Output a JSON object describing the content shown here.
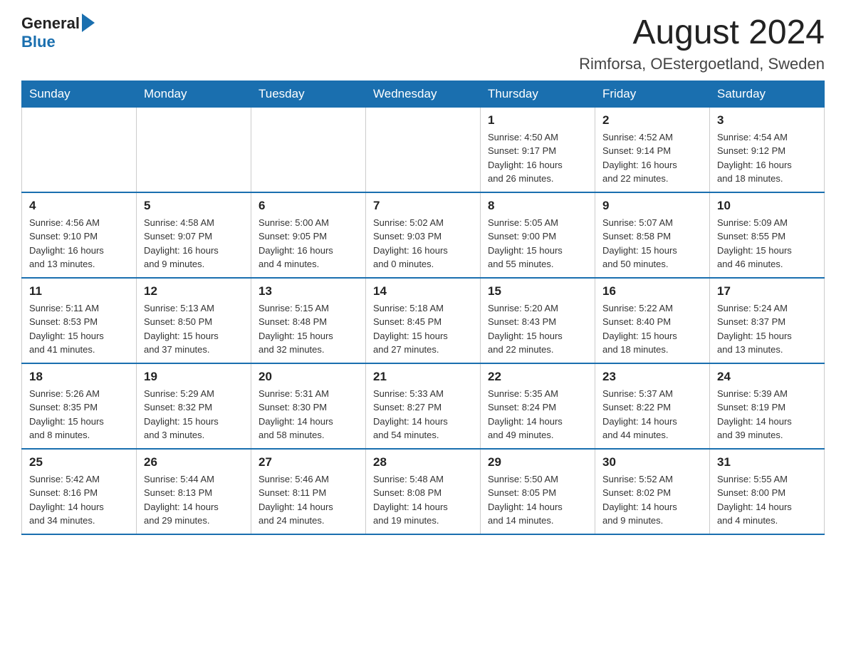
{
  "header": {
    "logo_general": "General",
    "logo_blue": "Blue",
    "month_year": "August 2024",
    "location": "Rimforsa, OEstergoetland, Sweden"
  },
  "days_of_week": [
    "Sunday",
    "Monday",
    "Tuesday",
    "Wednesday",
    "Thursday",
    "Friday",
    "Saturday"
  ],
  "weeks": [
    [
      {
        "day": "",
        "info": ""
      },
      {
        "day": "",
        "info": ""
      },
      {
        "day": "",
        "info": ""
      },
      {
        "day": "",
        "info": ""
      },
      {
        "day": "1",
        "info": "Sunrise: 4:50 AM\nSunset: 9:17 PM\nDaylight: 16 hours\nand 26 minutes."
      },
      {
        "day": "2",
        "info": "Sunrise: 4:52 AM\nSunset: 9:14 PM\nDaylight: 16 hours\nand 22 minutes."
      },
      {
        "day": "3",
        "info": "Sunrise: 4:54 AM\nSunset: 9:12 PM\nDaylight: 16 hours\nand 18 minutes."
      }
    ],
    [
      {
        "day": "4",
        "info": "Sunrise: 4:56 AM\nSunset: 9:10 PM\nDaylight: 16 hours\nand 13 minutes."
      },
      {
        "day": "5",
        "info": "Sunrise: 4:58 AM\nSunset: 9:07 PM\nDaylight: 16 hours\nand 9 minutes."
      },
      {
        "day": "6",
        "info": "Sunrise: 5:00 AM\nSunset: 9:05 PM\nDaylight: 16 hours\nand 4 minutes."
      },
      {
        "day": "7",
        "info": "Sunrise: 5:02 AM\nSunset: 9:03 PM\nDaylight: 16 hours\nand 0 minutes."
      },
      {
        "day": "8",
        "info": "Sunrise: 5:05 AM\nSunset: 9:00 PM\nDaylight: 15 hours\nand 55 minutes."
      },
      {
        "day": "9",
        "info": "Sunrise: 5:07 AM\nSunset: 8:58 PM\nDaylight: 15 hours\nand 50 minutes."
      },
      {
        "day": "10",
        "info": "Sunrise: 5:09 AM\nSunset: 8:55 PM\nDaylight: 15 hours\nand 46 minutes."
      }
    ],
    [
      {
        "day": "11",
        "info": "Sunrise: 5:11 AM\nSunset: 8:53 PM\nDaylight: 15 hours\nand 41 minutes."
      },
      {
        "day": "12",
        "info": "Sunrise: 5:13 AM\nSunset: 8:50 PM\nDaylight: 15 hours\nand 37 minutes."
      },
      {
        "day": "13",
        "info": "Sunrise: 5:15 AM\nSunset: 8:48 PM\nDaylight: 15 hours\nand 32 minutes."
      },
      {
        "day": "14",
        "info": "Sunrise: 5:18 AM\nSunset: 8:45 PM\nDaylight: 15 hours\nand 27 minutes."
      },
      {
        "day": "15",
        "info": "Sunrise: 5:20 AM\nSunset: 8:43 PM\nDaylight: 15 hours\nand 22 minutes."
      },
      {
        "day": "16",
        "info": "Sunrise: 5:22 AM\nSunset: 8:40 PM\nDaylight: 15 hours\nand 18 minutes."
      },
      {
        "day": "17",
        "info": "Sunrise: 5:24 AM\nSunset: 8:37 PM\nDaylight: 15 hours\nand 13 minutes."
      }
    ],
    [
      {
        "day": "18",
        "info": "Sunrise: 5:26 AM\nSunset: 8:35 PM\nDaylight: 15 hours\nand 8 minutes."
      },
      {
        "day": "19",
        "info": "Sunrise: 5:29 AM\nSunset: 8:32 PM\nDaylight: 15 hours\nand 3 minutes."
      },
      {
        "day": "20",
        "info": "Sunrise: 5:31 AM\nSunset: 8:30 PM\nDaylight: 14 hours\nand 58 minutes."
      },
      {
        "day": "21",
        "info": "Sunrise: 5:33 AM\nSunset: 8:27 PM\nDaylight: 14 hours\nand 54 minutes."
      },
      {
        "day": "22",
        "info": "Sunrise: 5:35 AM\nSunset: 8:24 PM\nDaylight: 14 hours\nand 49 minutes."
      },
      {
        "day": "23",
        "info": "Sunrise: 5:37 AM\nSunset: 8:22 PM\nDaylight: 14 hours\nand 44 minutes."
      },
      {
        "day": "24",
        "info": "Sunrise: 5:39 AM\nSunset: 8:19 PM\nDaylight: 14 hours\nand 39 minutes."
      }
    ],
    [
      {
        "day": "25",
        "info": "Sunrise: 5:42 AM\nSunset: 8:16 PM\nDaylight: 14 hours\nand 34 minutes."
      },
      {
        "day": "26",
        "info": "Sunrise: 5:44 AM\nSunset: 8:13 PM\nDaylight: 14 hours\nand 29 minutes."
      },
      {
        "day": "27",
        "info": "Sunrise: 5:46 AM\nSunset: 8:11 PM\nDaylight: 14 hours\nand 24 minutes."
      },
      {
        "day": "28",
        "info": "Sunrise: 5:48 AM\nSunset: 8:08 PM\nDaylight: 14 hours\nand 19 minutes."
      },
      {
        "day": "29",
        "info": "Sunrise: 5:50 AM\nSunset: 8:05 PM\nDaylight: 14 hours\nand 14 minutes."
      },
      {
        "day": "30",
        "info": "Sunrise: 5:52 AM\nSunset: 8:02 PM\nDaylight: 14 hours\nand 9 minutes."
      },
      {
        "day": "31",
        "info": "Sunrise: 5:55 AM\nSunset: 8:00 PM\nDaylight: 14 hours\nand 4 minutes."
      }
    ]
  ]
}
